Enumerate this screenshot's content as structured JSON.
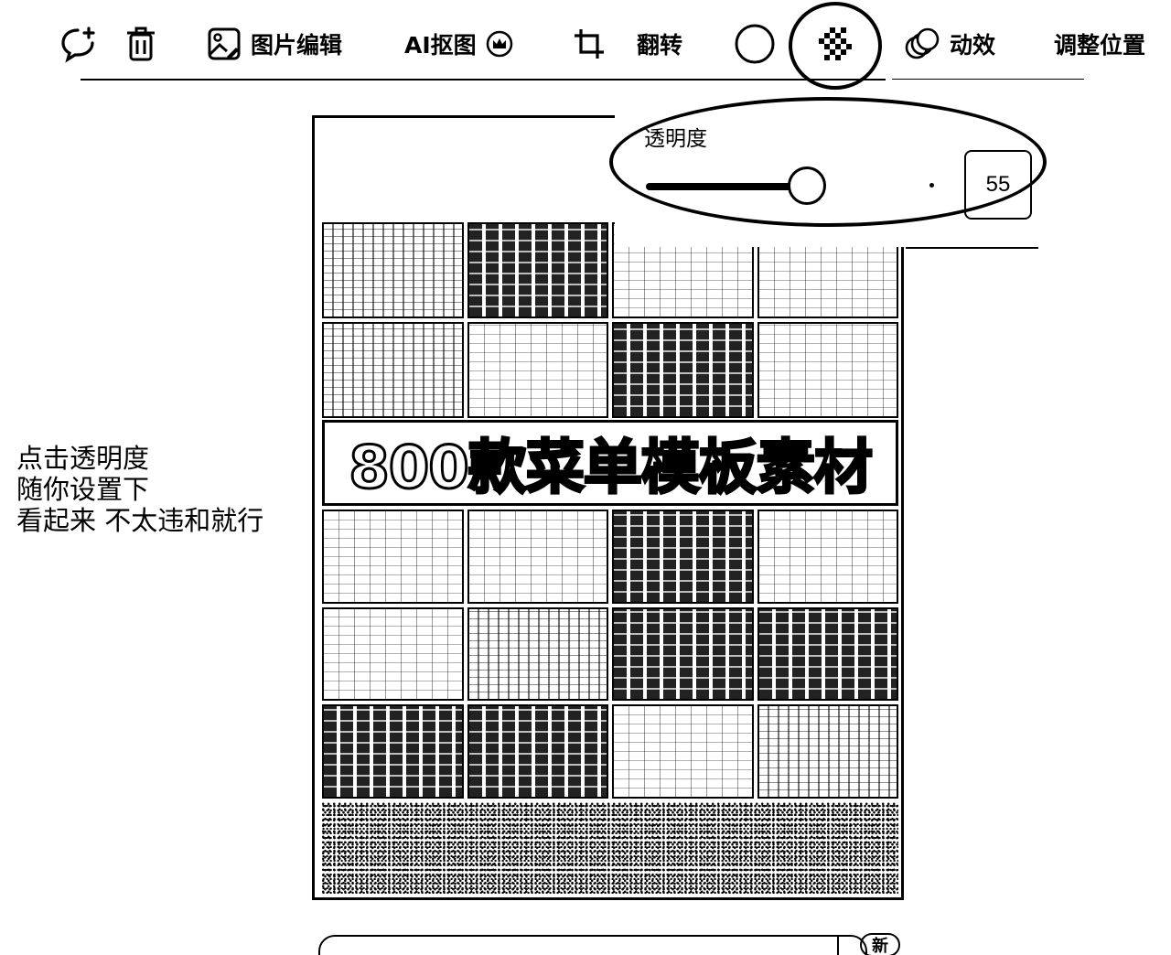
{
  "toolbar": {
    "items": [
      {
        "name": "comment-add-icon"
      },
      {
        "name": "trash-icon"
      },
      {
        "name": "image-edit-icon",
        "label": "图片编辑"
      },
      {
        "name": "ai-cutout",
        "label": "AI抠图",
        "badge_icon": "crown-icon"
      },
      {
        "name": "crop-icon"
      },
      {
        "name": "flip",
        "label": "翻转"
      },
      {
        "name": "color-circle-icon"
      },
      {
        "name": "transparency-icon"
      },
      {
        "name": "animation-icon",
        "label": "动效"
      },
      {
        "name": "adjust-position",
        "label": "调整位置"
      }
    ]
  },
  "opacity_popover": {
    "title": "透明度",
    "value": "55",
    "level_percent": 55
  },
  "annotation_note": {
    "lines": [
      "点击透明度",
      "随你设置下",
      "看起来 不太违和就行"
    ]
  },
  "poster": {
    "banner_text": "800款菜单模板素材"
  },
  "bottom_bar": {
    "badge": "新"
  }
}
